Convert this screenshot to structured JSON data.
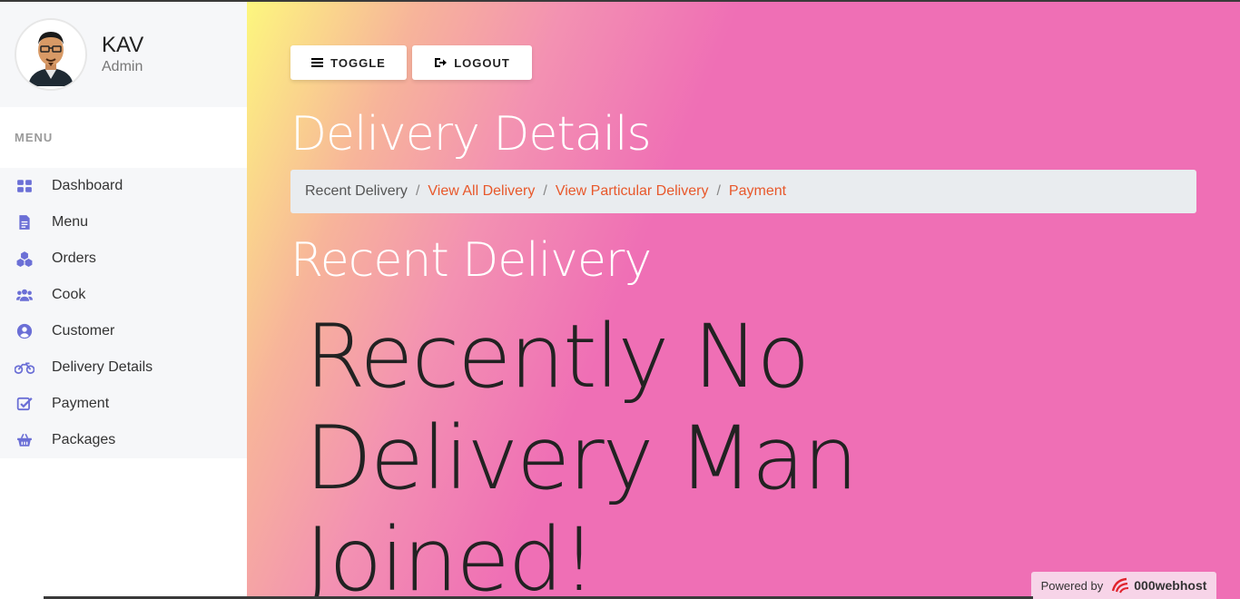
{
  "profile": {
    "name": "KAV",
    "role": "Admin"
  },
  "menu": {
    "heading": "MENU",
    "items": [
      {
        "label": "Dashboard",
        "icon": "dashboard-icon"
      },
      {
        "label": "Menu",
        "icon": "document-icon"
      },
      {
        "label": "Orders",
        "icon": "cubes-icon"
      },
      {
        "label": "Cook",
        "icon": "users-icon"
      },
      {
        "label": "Customer",
        "icon": "user-circle-icon"
      },
      {
        "label": "Delivery Details",
        "icon": "motorcycle-icon"
      },
      {
        "label": "Payment",
        "icon": "check-square-icon"
      },
      {
        "label": "Packages",
        "icon": "basket-icon"
      }
    ]
  },
  "toolbar": {
    "toggle_label": "TOGGLE",
    "logout_label": "LOGOUT"
  },
  "page": {
    "title": "Delivery Details",
    "breadcrumb": {
      "current": "Recent Delivery",
      "links": [
        "View All Delivery",
        "View Particular Delivery",
        "Payment"
      ]
    },
    "section_title": "Recent Delivery",
    "empty_message": "Recently No Delivery Man Joined!"
  },
  "footer": {
    "powered_label": "Powered by",
    "brand": "000webhost"
  },
  "colors": {
    "accent": "#6b6fd6",
    "link": "#e8582b",
    "gradient_start": "#fdf77e",
    "gradient_end": "#ef6fb5"
  }
}
